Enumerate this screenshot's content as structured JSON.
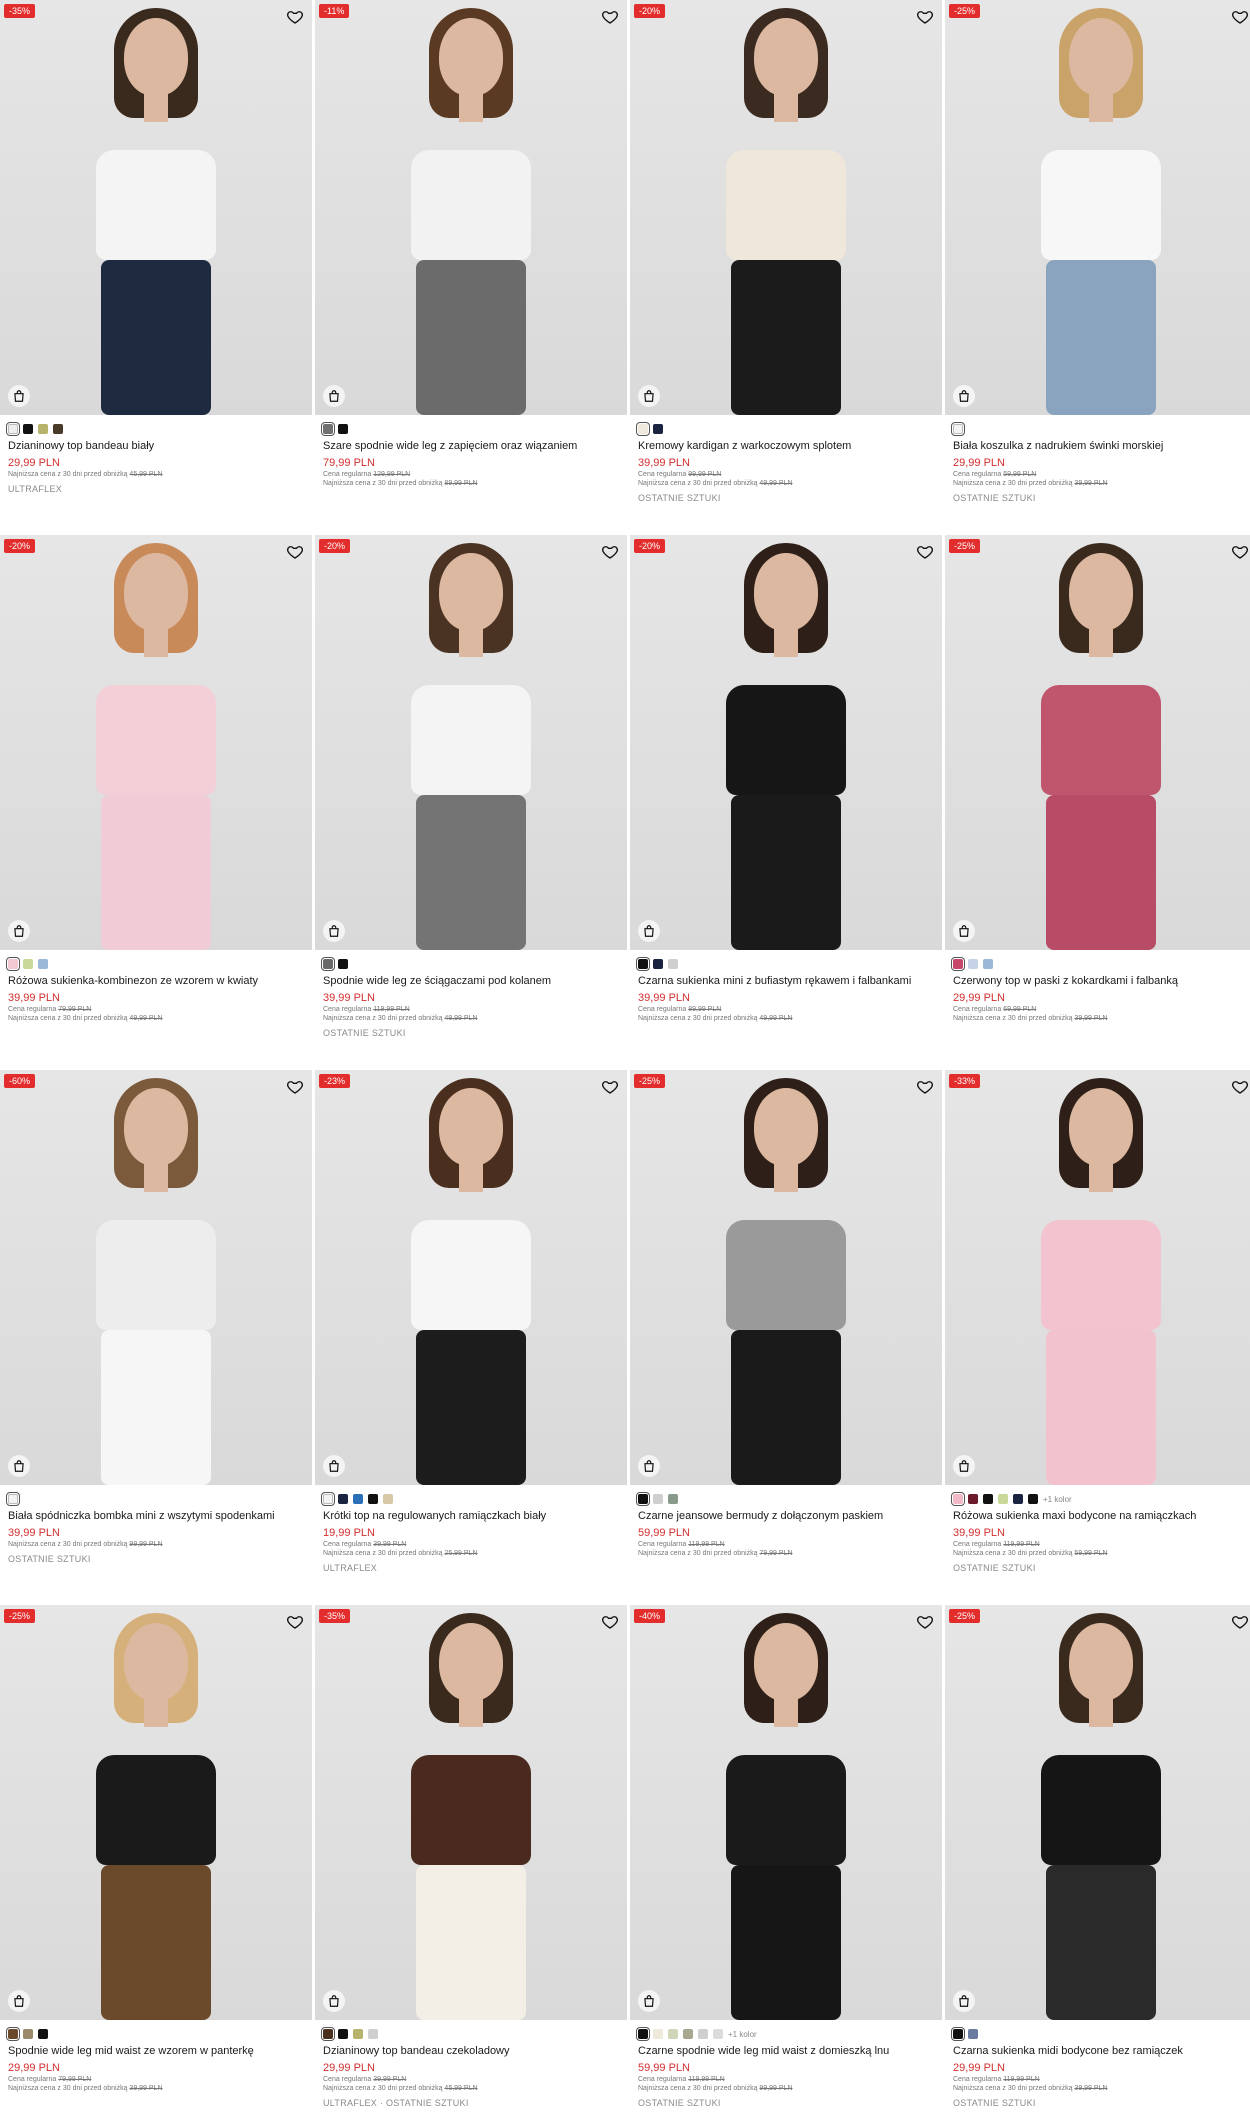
{
  "products": [
    {
      "badge": "-35%",
      "name": "Dzianinowy top bandeau biały",
      "price": "29,99 PLN",
      "regular_label": "",
      "regular_price": "",
      "lowest_label": "Najniższa cena z 30 dni przed obniżką",
      "lowest_price": "45,99 PLN",
      "tag": "ULTRAFLEX",
      "swatches": [
        "#eeeeee",
        "#111111",
        "#b8b36a",
        "#4a3a2a"
      ],
      "more": "",
      "top": "#f4f4f4",
      "bottom": "#1e2a40",
      "hair": "#3a2a1e"
    },
    {
      "badge": "-11%",
      "name": "Szare spodnie wide leg z zapięciem oraz wiązaniem",
      "price": "79,99 PLN",
      "regular_label": "Cena regularna",
      "regular_price": "129,99 PLN",
      "lowest_label": "Najniższa cena z 30 dni przed obniżką",
      "lowest_price": "89,99 PLN",
      "tag": "",
      "swatches": [
        "#707070",
        "#111111"
      ],
      "more": "",
      "top": "#f2f2f2",
      "bottom": "#6b6b6b",
      "hair": "#5a3a22"
    },
    {
      "badge": "-20%",
      "name": "Kremowy kardigan z warkoczowym splotem",
      "price": "39,99 PLN",
      "regular_label": "Cena regularna",
      "regular_price": "99,99 PLN",
      "lowest_label": "Najniższa cena z 30 dni przed obniżką",
      "lowest_price": "49,99 PLN",
      "tag": "OSTATNIE SZTUKI",
      "swatches": [
        "#efe9dc",
        "#1a2340"
      ],
      "more": "",
      "top": "#efe8da",
      "bottom": "#1b1b1b",
      "hair": "#3b2a20"
    },
    {
      "badge": "-25%",
      "name": "Biała koszulka z nadrukiem świnki morskiej",
      "price": "29,99 PLN",
      "regular_label": "Cena regularna",
      "regular_price": "59,99 PLN",
      "lowest_label": "Najniższa cena z 30 dni przed obniżką",
      "lowest_price": "39,99 PLN",
      "tag": "OSTATNIE SZTUKI",
      "swatches": [
        "#f4f4f4"
      ],
      "more": "",
      "top": "#f7f7f7",
      "bottom": "#8aa4c0",
      "hair": "#c9a36a"
    },
    {
      "badge": "-20%",
      "name": "Różowa sukienka-kombinezon ze wzorem w kwiaty",
      "price": "39,99 PLN",
      "regular_label": "Cena regularna",
      "regular_price": "79,99 PLN",
      "lowest_label": "Najniższa cena z 30 dni przed obniżką",
      "lowest_price": "49,99 PLN",
      "tag": "",
      "swatches": [
        "#f2c8d2",
        "#c9d99a",
        "#9ab8d8"
      ],
      "more": "",
      "top": "#f3cfd8",
      "bottom": "#f1cbd6",
      "hair": "#c98a5a"
    },
    {
      "badge": "-20%",
      "name": "Spodnie wide leg ze ściągaczami pod kolanem",
      "price": "39,99 PLN",
      "regular_label": "Cena regularna",
      "regular_price": "119,99 PLN",
      "lowest_label": "Najniższa cena z 30 dni przed obniżką",
      "lowest_price": "49,99 PLN",
      "tag": "OSTATNIE SZTUKI",
      "swatches": [
        "#6a6a6a",
        "#111111"
      ],
      "more": "",
      "top": "#f4f4f4",
      "bottom": "#747474",
      "hair": "#4a3322"
    },
    {
      "badge": "-20%",
      "name": "Czarna sukienka mini z bufiastym rękawem i falbankami",
      "price": "39,99 PLN",
      "regular_label": "Cena regularna",
      "regular_price": "89,99 PLN",
      "lowest_label": "Najniższa cena z 30 dni przed obniżką",
      "lowest_price": "49,99 PLN",
      "tag": "",
      "swatches": [
        "#111111",
        "#1a2340",
        "#cfcfcf"
      ],
      "more": "",
      "top": "#161616",
      "bottom": "#1a1a1a",
      "hair": "#2e2018"
    },
    {
      "badge": "-25%",
      "name": "Czerwony top w paski z kokardkami i falbanką",
      "price": "29,99 PLN",
      "regular_label": "Cena regularna",
      "regular_price": "69,99 PLN",
      "lowest_label": "Najniższa cena z 30 dni przed obniżką",
      "lowest_price": "39,99 PLN",
      "tag": "",
      "swatches": [
        "#c7476a",
        "#c6d2e6",
        "#9ab8d8"
      ],
      "more": "",
      "top": "#c0566e",
      "bottom": "#b84c66",
      "hair": "#3a2a1e"
    },
    {
      "badge": "-60%",
      "name": "Biała spódniczka bombka mini z wszytymi spodenkami",
      "price": "39,99 PLN",
      "regular_label": "",
      "regular_price": "",
      "lowest_label": "Najniższa cena z 30 dni przed obniżką",
      "lowest_price": "99,99 PLN",
      "tag": "OSTATNIE SZTUKI",
      "swatches": [
        "#f4f4f4"
      ],
      "more": "",
      "top": "#ededed",
      "bottom": "#f6f6f6",
      "hair": "#7a5a3a"
    },
    {
      "badge": "-23%",
      "name": "Krótki top na regulowanych ramiączkach biały",
      "price": "19,99 PLN",
      "regular_label": "Cena regularna",
      "regular_price": "39,99 PLN",
      "lowest_label": "Najniższa cena z 30 dni przed obniżką",
      "lowest_price": "25,99 PLN",
      "tag": "ULTRAFLEX",
      "swatches": [
        "#f4f4f4",
        "#1a2340",
        "#2a6fb8",
        "#111111",
        "#d8c8a8"
      ],
      "more": "",
      "top": "#f6f6f6",
      "bottom": "#1c1c1c",
      "hair": "#4a2e1e"
    },
    {
      "badge": "-25%",
      "name": "Czarne jeansowe bermudy z dołączonym paskiem",
      "price": "59,99 PLN",
      "regular_label": "Cena regularna",
      "regular_price": "119,99 PLN",
      "lowest_label": "Najniższa cena z 30 dni przed obniżką",
      "lowest_price": "79,99 PLN",
      "tag": "",
      "swatches": [
        "#111111",
        "#cfcfcf",
        "#8a9a8a"
      ],
      "more": "",
      "top": "#9a9a9a",
      "bottom": "#1a1a1a",
      "hair": "#2e2018"
    },
    {
      "badge": "-33%",
      "name": "Różowa sukienka maxi bodycone na ramiączkach",
      "price": "39,99 PLN",
      "regular_label": "Cena regularna",
      "regular_price": "119,99 PLN",
      "lowest_label": "Najniższa cena z 30 dni przed obniżką",
      "lowest_price": "59,99 PLN",
      "tag": "OSTATNIE SZTUKI",
      "swatches": [
        "#f2b8c6",
        "#6a1a2a",
        "#111111",
        "#c9d99a",
        "#1a2340",
        "#111111"
      ],
      "more": "+1 kolor",
      "top": "#f3c4cf",
      "bottom": "#f2c3ce",
      "hair": "#2e2018"
    },
    {
      "badge": "-25%",
      "name": "Spodnie wide leg mid waist ze wzorem w panterkę",
      "price": "29,99 PLN",
      "regular_label": "Cena regularna",
      "regular_price": "79,99 PLN",
      "lowest_label": "Najniższa cena z 30 dni przed obniżką",
      "lowest_price": "39,99 PLN",
      "tag": "",
      "swatches": [
        "#6a4a2a",
        "#9a8a6a",
        "#111111"
      ],
      "more": "",
      "top": "#1a1a1a",
      "bottom": "#6b4a2c",
      "hair": "#d6b07a"
    },
    {
      "badge": "-35%",
      "name": "Dzianinowy top bandeau czekoladowy",
      "price": "29,99 PLN",
      "regular_label": "Cena regularna",
      "regular_price": "39,99 PLN",
      "lowest_label": "Najniższa cena z 30 dni przed obniżką",
      "lowest_price": "45,99 PLN",
      "tag": "ULTRAFLEX · OSTATNIE SZTUKI",
      "swatches": [
        "#4a2e1e",
        "#111111",
        "#b8b36a",
        "#cfcfcf"
      ],
      "more": "",
      "top": "#4a2a1e",
      "bottom": "#f3efe6",
      "hair": "#3a2a1e"
    },
    {
      "badge": "-40%",
      "name": "Czarne spodnie wide leg mid waist z domieszką lnu",
      "price": "59,99 PLN",
      "regular_label": "Cena regularna",
      "regular_price": "119,99 PLN",
      "lowest_label": "Najniższa cena z 30 dni przed obniżką",
      "lowest_price": "99,99 PLN",
      "tag": "OSTATNIE SZTUKI",
      "swatches": [
        "#111111",
        "#efe9dc",
        "#cfd6b8",
        "#a8a890",
        "#cfcfcf",
        "#dcdcdc"
      ],
      "more": "+1 kolor",
      "top": "#1a1a1a",
      "bottom": "#161616",
      "hair": "#2e2018"
    },
    {
      "badge": "-25%",
      "name": "Czarna sukienka midi bodycone bez ramiączek",
      "price": "29,99 PLN",
      "regular_label": "Cena regularna",
      "regular_price": "119,99 PLN",
      "lowest_label": "Najniższa cena z 30 dni przed obniżką",
      "lowest_price": "39,99 PLN",
      "tag": "OSTATNIE SZTUKI",
      "swatches": [
        "#111111",
        "#6a7aa0"
      ],
      "more": "",
      "top": "#151515",
      "bottom": "#2a2a2a",
      "hair": "#3a2a1e"
    }
  ]
}
